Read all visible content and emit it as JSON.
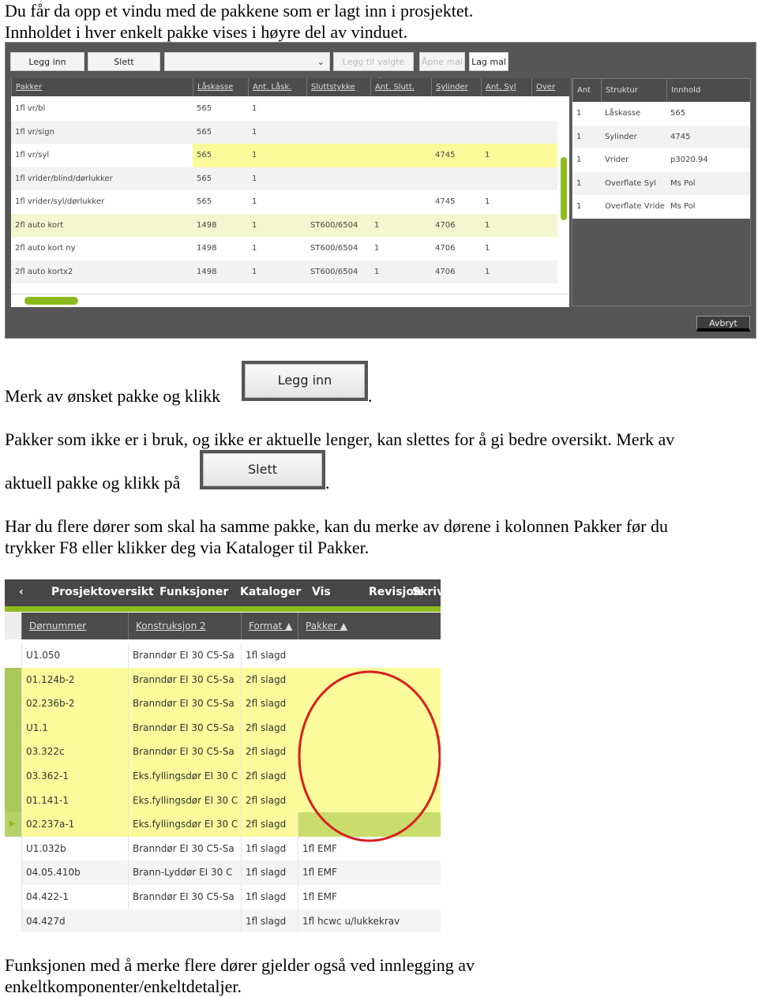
{
  "intro": [
    "Du får da opp et vindu med de pakkene som er lagt inn i prosjektet.",
    "Innholdet i hver enkelt pakke vises i høyre del av vinduet."
  ],
  "dialog": {
    "toolbar": {
      "legg_inn": "Legg inn",
      "slett": "Slett",
      "dropdown_value": "",
      "legg_til_valgte_mal": "Legg til valgte mal",
      "apne_mal": "Åpne mal",
      "lag_mal": "Lag mal"
    },
    "columns": [
      "Pakker",
      "Låskasse",
      "Ant. Låsk.",
      "Sluttstykke",
      "Ant. Slutt.",
      "Sylinder",
      "Ant. Syl",
      "Over"
    ],
    "rows": [
      [
        "1fl vr/bl",
        "565",
        "1",
        "",
        "",
        "",
        "",
        ""
      ],
      [
        "1fl vr/sign",
        "565",
        "1",
        "",
        "",
        "",
        "",
        ""
      ],
      [
        "1fl vr/syl",
        "565",
        "1",
        "",
        "",
        "4745",
        "1",
        ""
      ],
      [
        "1fl vrider/blind/dørlukker",
        "565",
        "1",
        "",
        "",
        "",
        "",
        ""
      ],
      [
        "1fl vrider/syl/dørlukker",
        "565",
        "1",
        "",
        "",
        "4745",
        "1",
        ""
      ],
      [
        "2fl auto kort",
        "1498",
        "1",
        "ST600/6504",
        "1",
        "4706",
        "1",
        ""
      ],
      [
        "2fl auto kort ny",
        "1498",
        "1",
        "ST600/6504",
        "1",
        "4706",
        "1",
        ""
      ],
      [
        "2fl auto kortx2",
        "1498",
        "1",
        "ST600/6504",
        "1",
        "4706",
        "1",
        ""
      ]
    ],
    "selected_row": 2,
    "detail_columns": [
      "Ant",
      "Struktur",
      "Innhold"
    ],
    "detail_rows": [
      [
        "1",
        "Låskasse",
        "565"
      ],
      [
        "1",
        "Sylinder",
        "4745"
      ],
      [
        "1",
        "Vrider",
        "p3020.94"
      ],
      [
        "1",
        "Overflate Syl",
        "Ms Pol"
      ],
      [
        "1",
        "Overflate Vride",
        "Ms Pol"
      ]
    ],
    "avbryt": "Avbryt"
  },
  "para1": {
    "text": "Merk av ønsket pakke og klikk",
    "button": "Legg inn",
    "after": "."
  },
  "para2": {
    "line1": "Pakker som ikke er i bruk, og ikke er aktuelle lenger, kan slettes for å gi bedre oversikt. Merk av",
    "line2": "aktuell pakke og klikk på",
    "button": "Slett",
    "after": "."
  },
  "para3": [
    "Har du flere dører som skal ha samme pakke, kan du merke av dørene i kolonnen Pakker før du",
    "trykker F8 eller klikker deg via Kataloger til Pakker."
  ],
  "app": {
    "menu": [
      "Prosjektoversikt",
      "Funksjoner",
      "Kataloger",
      "Vis",
      "Revisjon",
      "Skriv"
    ],
    "columns": [
      "Dørnummer",
      "Konstruksjon 2",
      "Format ▲",
      "Pakker ▲"
    ],
    "rows": [
      [
        "U1.050",
        "Branndør EI 30 C5-Sa",
        "1fl slagd",
        ""
      ],
      [
        "01.124b-2",
        "Branndør EI 30 C5-Sa",
        "2fl slagd",
        ""
      ],
      [
        "02.236b-2",
        "Branndør EI 30 C5-Sa",
        "2fl slagd",
        ""
      ],
      [
        "U1.1",
        "Branndør EI 30 C5-Sa",
        "2fl slagd",
        ""
      ],
      [
        "03.322c",
        "Branndør EI 30 C5-Sa",
        "2fl slagd",
        ""
      ],
      [
        "03.362-1",
        "Eks.fyllingsdør EI 30 C",
        "2fl slagd",
        ""
      ],
      [
        "01.141-1",
        "Eks.fyllingsdør EI 30 C",
        "2fl slagd",
        ""
      ],
      [
        "02.237a-1",
        "Eks.fyllingsdør EI 30 C",
        "2fl slagd",
        ""
      ],
      [
        "U1.032b",
        "Branndør EI 30 C5-Sa",
        "1fl slagd",
        "1fl EMF"
      ],
      [
        "04.05.410b",
        "Brann-Lyddør EI 30 C",
        "1fl slagd",
        "1fl EMF"
      ],
      [
        "04.422-1",
        "Branndør EI 30 C5-Sa",
        "1fl slagd",
        "1fl EMF"
      ],
      [
        "04.427d",
        "",
        "1fl slagd",
        "1fl hcwc u/lukkekrav"
      ]
    ],
    "selected_rows": [
      1,
      2,
      3,
      4,
      5,
      6,
      7
    ],
    "current_row": 7,
    "colors": {
      "accent": "#8dba1e",
      "selected": "#fbfb9c",
      "annotation": "#d81f1f"
    }
  },
  "outro": [
    "Funksjonen med å merke flere dører gjelder også ved innlegging av",
    "enkeltkomponenter/enkeltdetaljer."
  ]
}
